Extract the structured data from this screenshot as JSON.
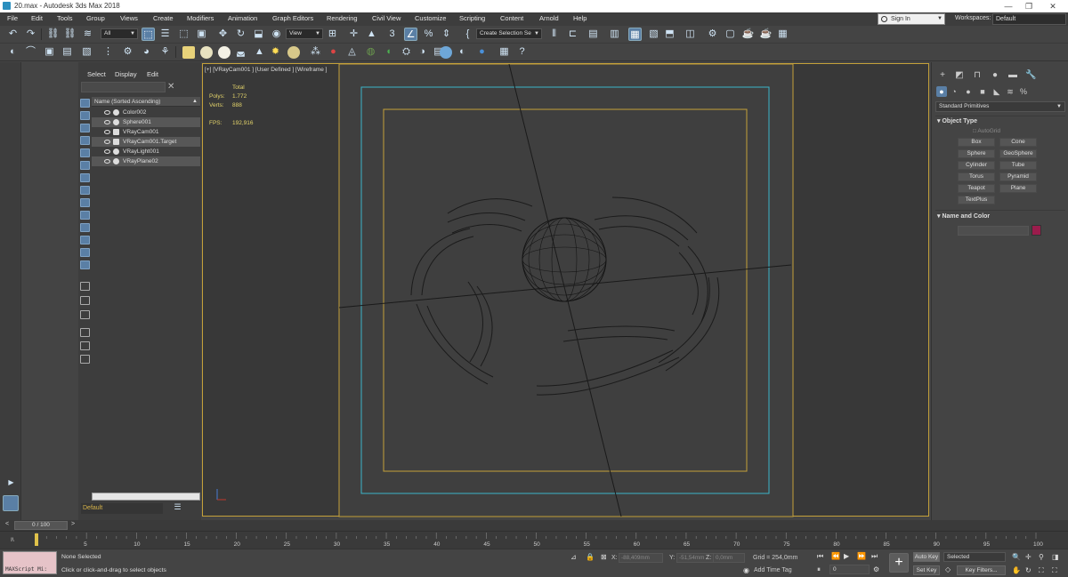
{
  "window": {
    "title": "20.max - Autodesk 3ds Max 2018",
    "min": "—",
    "max": "❐",
    "close": "✕"
  },
  "menu": [
    "File",
    "Edit",
    "Tools",
    "Group",
    "Views",
    "Create",
    "Modifiers",
    "Animation",
    "Graph Editors",
    "Rendering",
    "Civil View",
    "Customize",
    "Scripting",
    "Content",
    "Arnold",
    "Help"
  ],
  "account": {
    "signin": "Sign In",
    "workspaces_label": "Workspaces:",
    "workspace": "Default"
  },
  "toolbar": {
    "filter": "All",
    "coord": "View",
    "selection_set": "Create Selection Se",
    "angle_snap": "3",
    "percent_snap": "%"
  },
  "explorer": {
    "tabs": [
      "Select",
      "Display",
      "Edit"
    ],
    "header": "Name (Sorted Ascending)",
    "items": [
      "Color002",
      "Sphere001",
      "VRayCam001",
      "VRayCam001.Target",
      "VRayLight001",
      "VRayPlane02"
    ],
    "layer": "Default"
  },
  "viewport": {
    "label": "[+] [VRayCam001 ] [User Defined ] [Wireframe ]",
    "stats": {
      "total": "Total",
      "polys_label": "Polys:",
      "polys": "1.772",
      "verts_label": "Verts:",
      "verts": "888",
      "fps_label": "FPS:",
      "fps": "192,916"
    }
  },
  "command_panel": {
    "category": "Standard Primitives",
    "object_type": "Object Type",
    "autogrid": "AutoGrid",
    "primitives": [
      "Box",
      "Cone",
      "Sphere",
      "GeoSphere",
      "Cylinder",
      "Tube",
      "Torus",
      "Pyramid",
      "Teapot",
      "Plane",
      "TextPlus"
    ],
    "name_and_color": "Name and Color",
    "color": "#9b1c4c"
  },
  "timeline": {
    "frame": "0 / 100",
    "ticks": [
      "0",
      "5",
      "10",
      "15",
      "20",
      "25",
      "30",
      "35",
      "40",
      "45",
      "50",
      "55",
      "60",
      "65",
      "70",
      "75",
      "80",
      "85",
      "90",
      "95",
      "100"
    ]
  },
  "status": {
    "maxscript": "MAXScript Mi:",
    "selection": "None Selected",
    "hint": "Click or click-and-drag to select objects",
    "x_label": "X:",
    "x": "-88,409mm",
    "y_label": "Y:",
    "y": "-51,54mm",
    "z_label": "Z:",
    "z": "0,0mm",
    "grid": "Grid = 254,0mm",
    "add_time_tag": "Add Time Tag",
    "current_frame": "0",
    "auto_key": "Auto Key",
    "set_key": "Set Key",
    "key_mode": "Selected",
    "key_filters": "Key Filters..."
  }
}
